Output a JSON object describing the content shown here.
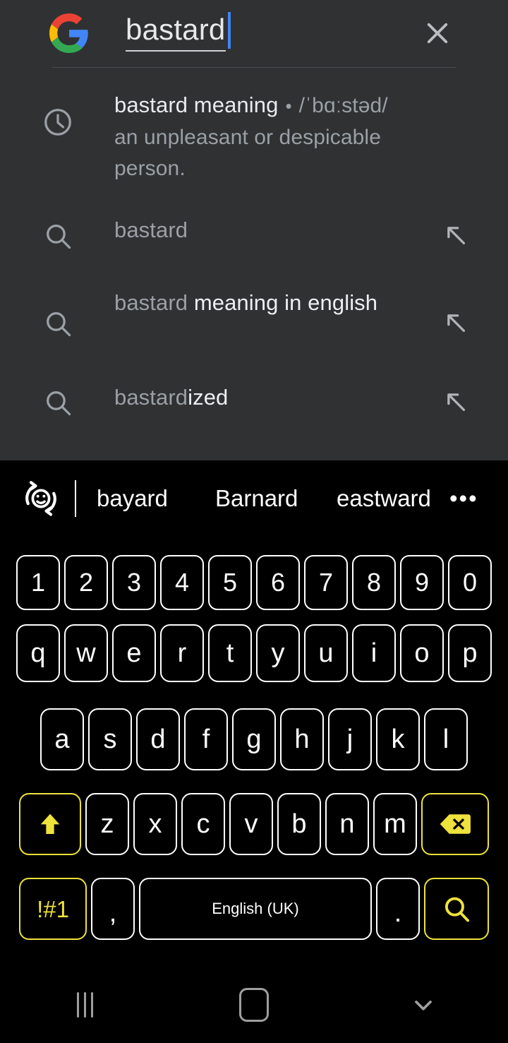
{
  "search": {
    "logo_icon": "google-g-logo",
    "query": "bastard",
    "clear_icon": "close-x-icon",
    "suggestions": [
      {
        "icon": "clock-history-icon",
        "type": "history-definition",
        "main": "bastard meaning",
        "separator": "•",
        "phonetic": "/ˈbɑːstəd/",
        "definition": "an unpleasant or despicable person.",
        "arrow_icon": "arrow-up-left-icon",
        "has_arrow": false
      },
      {
        "icon": "search-magnifier-icon",
        "type": "query",
        "prefix": "bastard",
        "completion": "",
        "arrow_icon": "arrow-up-left-icon",
        "has_arrow": true
      },
      {
        "icon": "search-magnifier-icon",
        "type": "query",
        "prefix": "bastard ",
        "completion": "meaning in english",
        "arrow_icon": "arrow-up-left-icon",
        "has_arrow": true
      },
      {
        "icon": "search-magnifier-icon",
        "type": "query",
        "prefix": "bastard",
        "completion": "ized",
        "arrow_icon": "arrow-up-left-icon",
        "has_arrow": true
      }
    ]
  },
  "keyboard": {
    "emoji_toggle_icon": "emoji-rotate-icon",
    "suggestion_words": [
      "bayard",
      "Barnard",
      "eastward"
    ],
    "more_label": "•••",
    "rows": {
      "numbers": [
        "1",
        "2",
        "3",
        "4",
        "5",
        "6",
        "7",
        "8",
        "9",
        "0"
      ],
      "top": [
        "q",
        "w",
        "e",
        "r",
        "t",
        "y",
        "u",
        "i",
        "o",
        "p"
      ],
      "middle": [
        "a",
        "s",
        "d",
        "f",
        "g",
        "h",
        "j",
        "k",
        "l"
      ],
      "bottom": [
        "z",
        "x",
        "c",
        "v",
        "b",
        "n",
        "m"
      ]
    },
    "shift_icon": "shift-arrow-up-icon",
    "backspace_icon": "backspace-delete-icon",
    "symbols_label": "!#1",
    "comma_label": ",",
    "space_label": "English (UK)",
    "period_label": ".",
    "search_key_icon": "search-magnifier-icon",
    "accent_color": "#eee23c"
  },
  "nav_bar": {
    "recents_icon": "recents-bars-icon",
    "home_icon": "home-square-icon",
    "dismiss_icon": "chevron-down-icon"
  }
}
